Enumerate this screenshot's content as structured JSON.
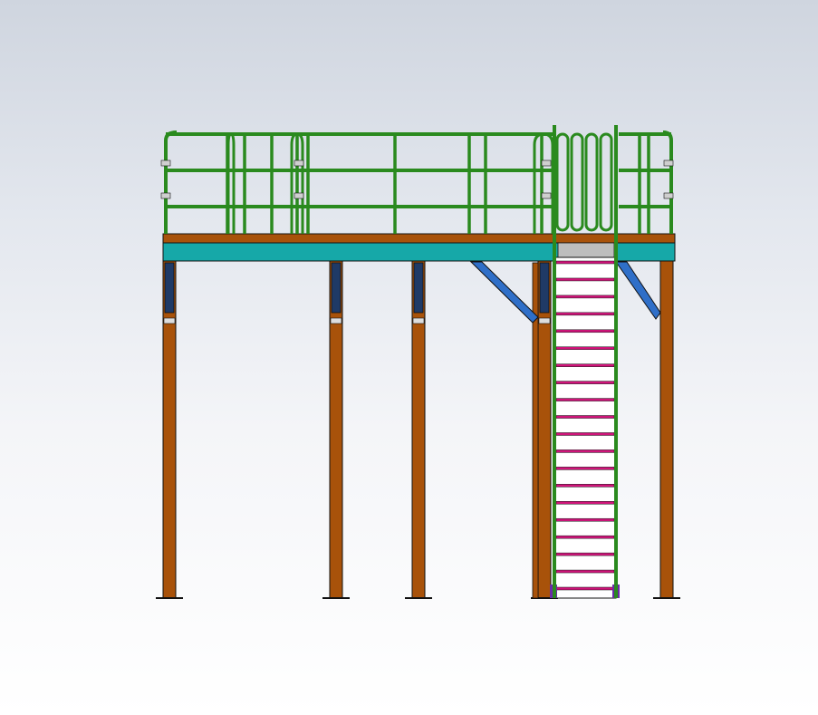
{
  "scene": {
    "subject": "",
    "colors": {
      "background_top": "#cfd5df",
      "background_bottom": "#ffffff",
      "steel_column": "#a8520a",
      "steel_column_dark": "#7a3a05",
      "deck_beam": "#16a8a8",
      "deck_plate": "#a8520a",
      "guardrail": "#2a8a1e",
      "guardrail_dark": "#1d5e14",
      "brace": "#2f6fc8",
      "column_cap": "#1f3a66",
      "stair_tread_edge": "#d0147a",
      "stair_tread": "#ffffff",
      "landing": "#bdbdbd",
      "outline": "#111111"
    },
    "parts": {
      "columns": 5,
      "braces": 2,
      "stair_treads": 20,
      "guardrail_rails": 3,
      "safety_gate_loops": 4
    }
  }
}
